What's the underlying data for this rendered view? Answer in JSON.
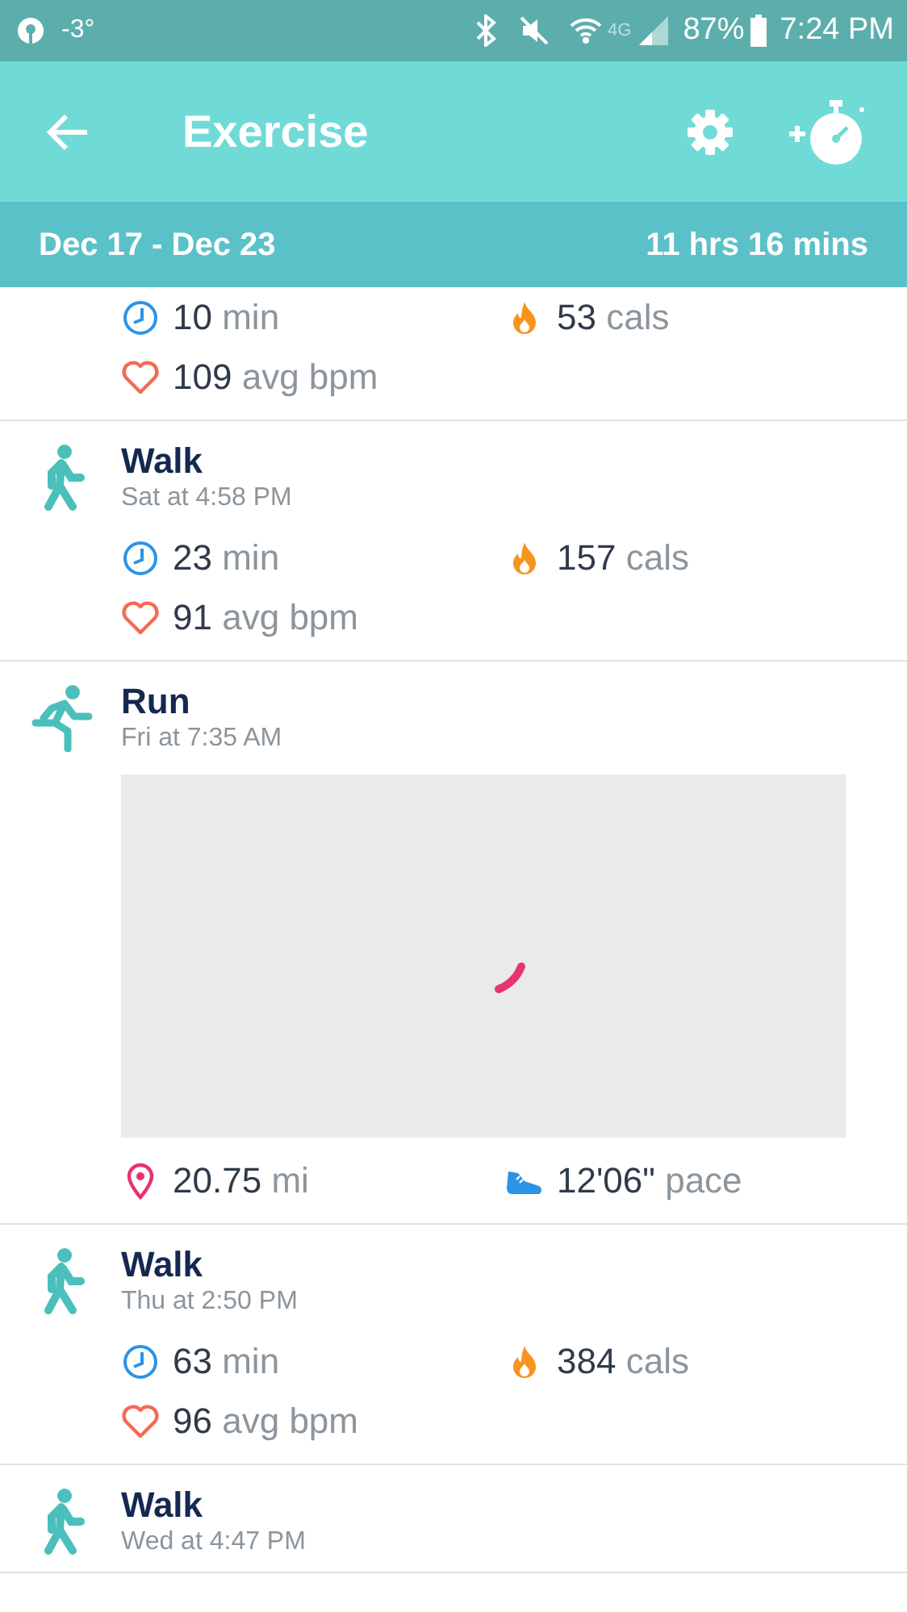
{
  "status_bar": {
    "temperature": "-3°",
    "network": "4G",
    "battery": "87%",
    "time": "7:24 PM"
  },
  "app_bar": {
    "title": "Exercise"
  },
  "summary": {
    "range": "Dec 17 - Dec 23",
    "total": "11 hrs 16 mins"
  },
  "entries": [
    {
      "stats": [
        {
          "kind": "duration",
          "value": "10",
          "unit": "min"
        },
        {
          "kind": "calories",
          "value": "53",
          "unit": "cals"
        },
        {
          "kind": "heart",
          "value": "109",
          "unit": "avg bpm"
        }
      ]
    },
    {
      "kind": "walk",
      "title": "Walk",
      "time": "Sat at 4:58 PM",
      "stats": [
        {
          "kind": "duration",
          "value": "23",
          "unit": "min"
        },
        {
          "kind": "calories",
          "value": "157",
          "unit": "cals"
        },
        {
          "kind": "heart",
          "value": "91",
          "unit": "avg bpm"
        }
      ]
    },
    {
      "kind": "run",
      "title": "Run",
      "time": "Fri at 7:35 AM",
      "map": {
        "kind": "picture"
      },
      "stats": [
        {
          "kind": "distance",
          "value": "20.75",
          "unit": "mi"
        },
        {
          "kind": "pace",
          "value": "12'06\"",
          "unit": "pace"
        }
      ]
    },
    {
      "kind": "walk",
      "title": "Walk",
      "time": "Thu at 2:50 PM",
      "stats": [
        {
          "kind": "duration",
          "value": "63",
          "unit": "min"
        },
        {
          "kind": "calories",
          "value": "384",
          "unit": "cals"
        },
        {
          "kind": "heart",
          "value": "96",
          "unit": "avg bpm"
        }
      ]
    },
    {
      "kind": "walk",
      "title": "Walk",
      "time": "Wed at 4:47 PM"
    }
  ]
}
